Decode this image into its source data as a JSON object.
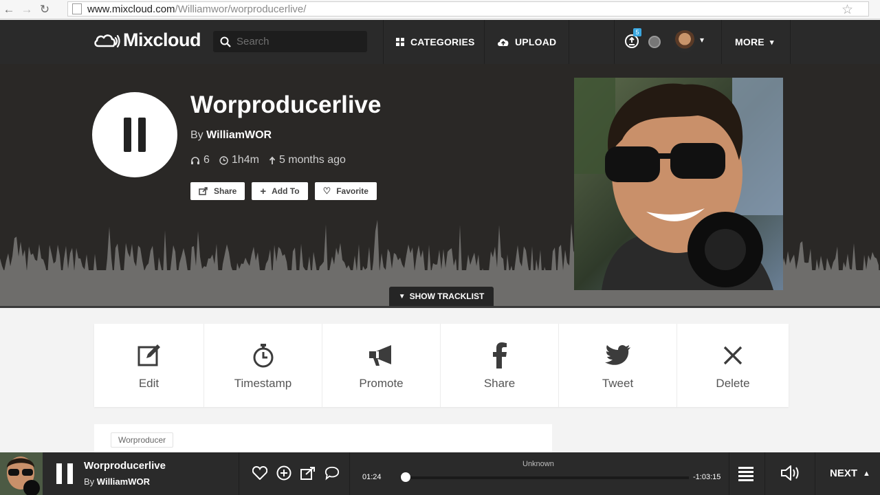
{
  "browser": {
    "url_host": "www.mixcloud.com",
    "url_path": "/Williamwor/worproducerlive/"
  },
  "header": {
    "logo_text": "Mixcloud",
    "search_placeholder": "Search",
    "nav": [
      {
        "label": "CATEGORIES",
        "icon": "grid-icon"
      },
      {
        "label": "UPLOAD",
        "icon": "cloud-upload-icon"
      }
    ],
    "notification_count": "5",
    "more_label": "MORE"
  },
  "show": {
    "title": "Worproducerlive",
    "by_prefix": "By",
    "author": "WilliamWOR",
    "listens": "6",
    "duration": "1h4m",
    "uploaded": "5 months ago",
    "buttons": {
      "share": "Share",
      "add_to": "Add To",
      "favorite": "Favorite"
    },
    "show_tracklist": "SHOW TRACKLIST"
  },
  "actions": [
    {
      "label": "Edit",
      "icon": "edit-icon"
    },
    {
      "label": "Timestamp",
      "icon": "stopwatch-icon"
    },
    {
      "label": "Promote",
      "icon": "megaphone-icon"
    },
    {
      "label": "Share",
      "icon": "facebook-icon"
    },
    {
      "label": "Tweet",
      "icon": "twitter-icon"
    },
    {
      "label": "Delete",
      "icon": "close-icon"
    }
  ],
  "tags": [
    "Worproducer"
  ],
  "player": {
    "title": "Worproducerlive",
    "by_prefix": "By",
    "author": "WilliamWOR",
    "track_name": "Unknown",
    "elapsed": "01:24",
    "remaining": "-1:03:15",
    "progress_fraction": 0.02,
    "next_label": "NEXT"
  },
  "colors": {
    "header_bg": "#2a2a2a",
    "hero_bg": "#2a2826",
    "waveform": "#6e6d6b",
    "accent": "#3aa7e0"
  }
}
